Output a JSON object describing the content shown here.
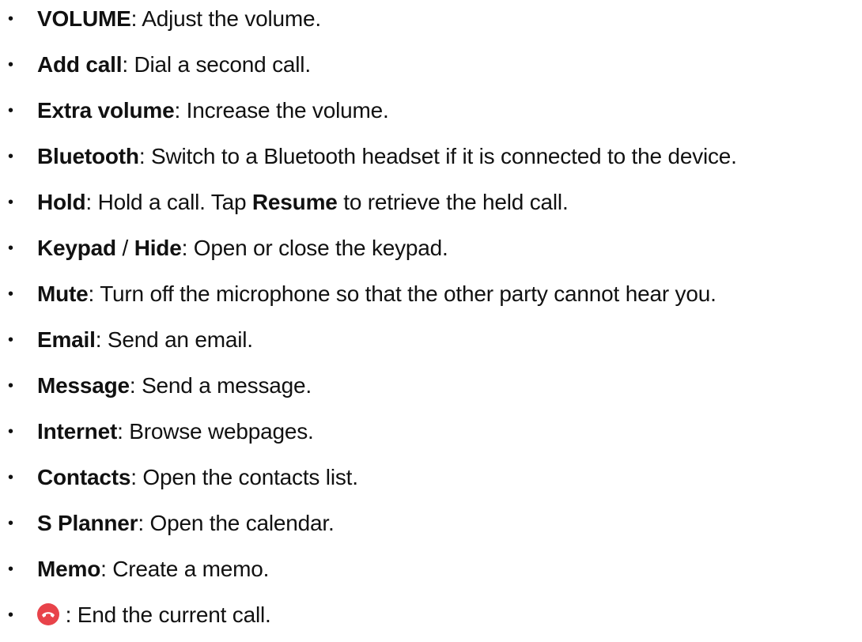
{
  "items": [
    {
      "term": "VOLUME",
      "sep": ": ",
      "desc": "Adjust the volume."
    },
    {
      "term": "Add call",
      "sep": ": ",
      "desc": "Dial a second call."
    },
    {
      "term": "Extra volume",
      "sep": ": ",
      "desc": "Increase the volume."
    },
    {
      "term": "Bluetooth",
      "sep": ": ",
      "desc": "Switch to a Bluetooth headset if it is connected to the device."
    },
    {
      "term": "Hold",
      "sep": ": ",
      "desc": "Hold a call. Tap ",
      "term2": "Resume",
      "desc2": " to retrieve the held call."
    },
    {
      "term": "Keypad",
      "mid": " / ",
      "term2": "Hide",
      "sep": ": ",
      "desc": "Open or close the keypad."
    },
    {
      "term": "Mute",
      "sep": ": ",
      "desc": "Turn off the microphone so that the other party cannot hear you."
    },
    {
      "term": "Email",
      "sep": ": ",
      "desc": "Send an email."
    },
    {
      "term": "Message",
      "sep": ": ",
      "desc": "Send a message."
    },
    {
      "term": "Internet",
      "sep": ": ",
      "desc": "Browse webpages."
    },
    {
      "term": "Contacts",
      "sep": ": ",
      "desc": "Open the contacts list."
    },
    {
      "term": "S Planner",
      "sep": ": ",
      "desc": "Open the calendar."
    },
    {
      "term": "Memo",
      "sep": ": ",
      "desc": "Create a memo."
    },
    {
      "icon": "end-call-icon",
      "sep": " : ",
      "desc": "End the current call."
    }
  ],
  "bullet_glyph": "•",
  "colors": {
    "text": "#111111",
    "end_call_red": "#e8434a"
  }
}
